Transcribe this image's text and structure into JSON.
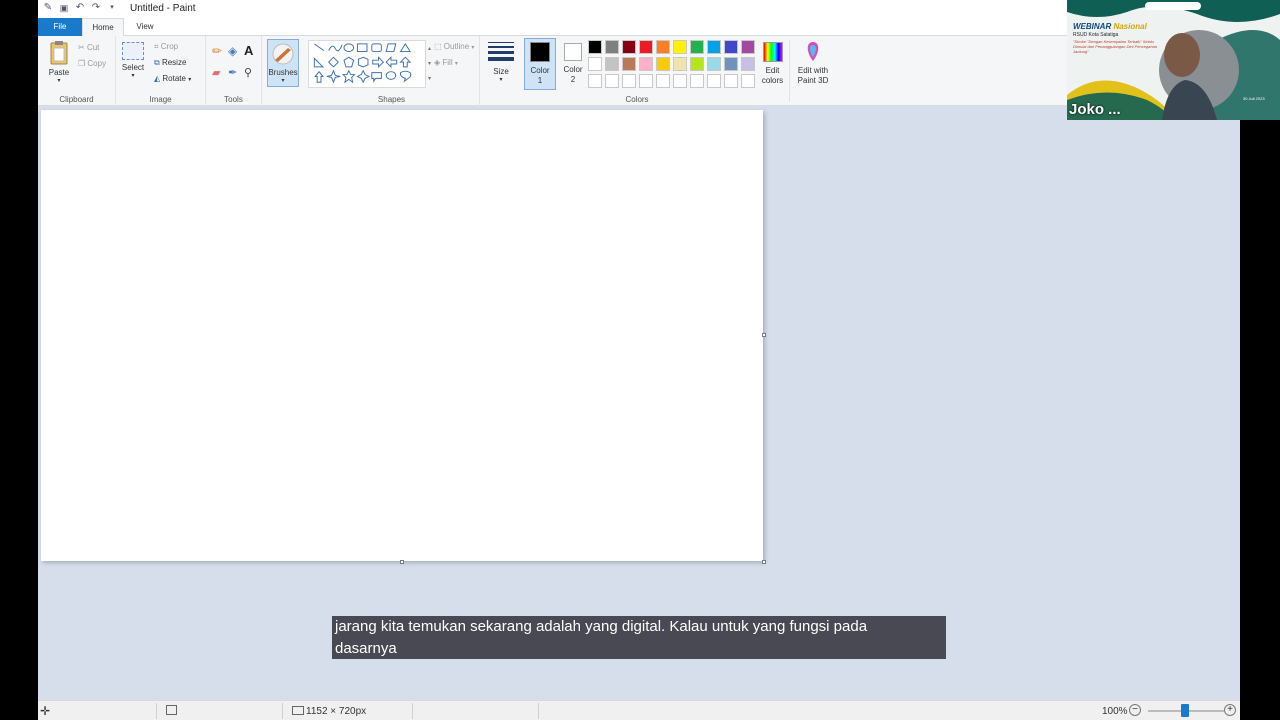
{
  "window": {
    "title": "Untitled - Paint"
  },
  "tabs": {
    "file": "File",
    "home": "Home",
    "view": "View"
  },
  "clipboard": {
    "paste": "Paste",
    "cut": "Cut",
    "copy": "Copy",
    "label": "Clipboard"
  },
  "image": {
    "select": "Select",
    "crop": "Crop",
    "resize": "Resize",
    "rotate": "Rotate",
    "label": "Image"
  },
  "tools": {
    "label": "Tools",
    "text_glyph": "A"
  },
  "brushes": {
    "label": "Brushes"
  },
  "shapes": {
    "outline": "Outline",
    "fill": "Fill",
    "label": "Shapes"
  },
  "size": {
    "label": "Size"
  },
  "colors": {
    "color1_label": "Color 1",
    "color2_label": "Color 2",
    "label": "Colors",
    "edit_colors": "Edit colors",
    "edit_paint3d": "Edit with Paint 3D",
    "color1_value": "#000000",
    "color2_value": "#ffffff",
    "palette_row1": [
      "#000000",
      "#7f7f7f",
      "#880015",
      "#ed1c24",
      "#ff7f27",
      "#fff200",
      "#22b14c",
      "#00a2e8",
      "#3f48cc",
      "#a349a4"
    ],
    "palette_row2": [
      "#ffffff",
      "#c3c3c3",
      "#b97a57",
      "#ffaec9",
      "#ffc90e",
      "#efe4b0",
      "#b5e61d",
      "#99d9ea",
      "#7092be",
      "#c8bfe7"
    ],
    "palette_row3": [
      "#ffffff",
      "#ffffff",
      "#ffffff",
      "#ffffff",
      "#ffffff",
      "#ffffff",
      "#ffffff",
      "#ffffff",
      "#ffffff",
      "#ffffff"
    ]
  },
  "caption": {
    "line1": "jarang kita temukan sekarang adalah yang digital. Kalau untuk yang fungsi pada",
    "line2": "dasarnya"
  },
  "status": {
    "dimensions": "1152 × 720px",
    "zoom": "100%",
    "zoom_level": 1.0
  },
  "video": {
    "name": "Joko ...",
    "title": "WEBINAR",
    "title_accent": "Nasional",
    "org": "RSUD Kota Salatiga",
    "theme": "\"Stroke \"Dengan Kesempatan Terbaik\" Selalu Dimulai dari Penanggulangan Dini Pencegahan Jantung\"",
    "date": "30 Juli 2023"
  }
}
